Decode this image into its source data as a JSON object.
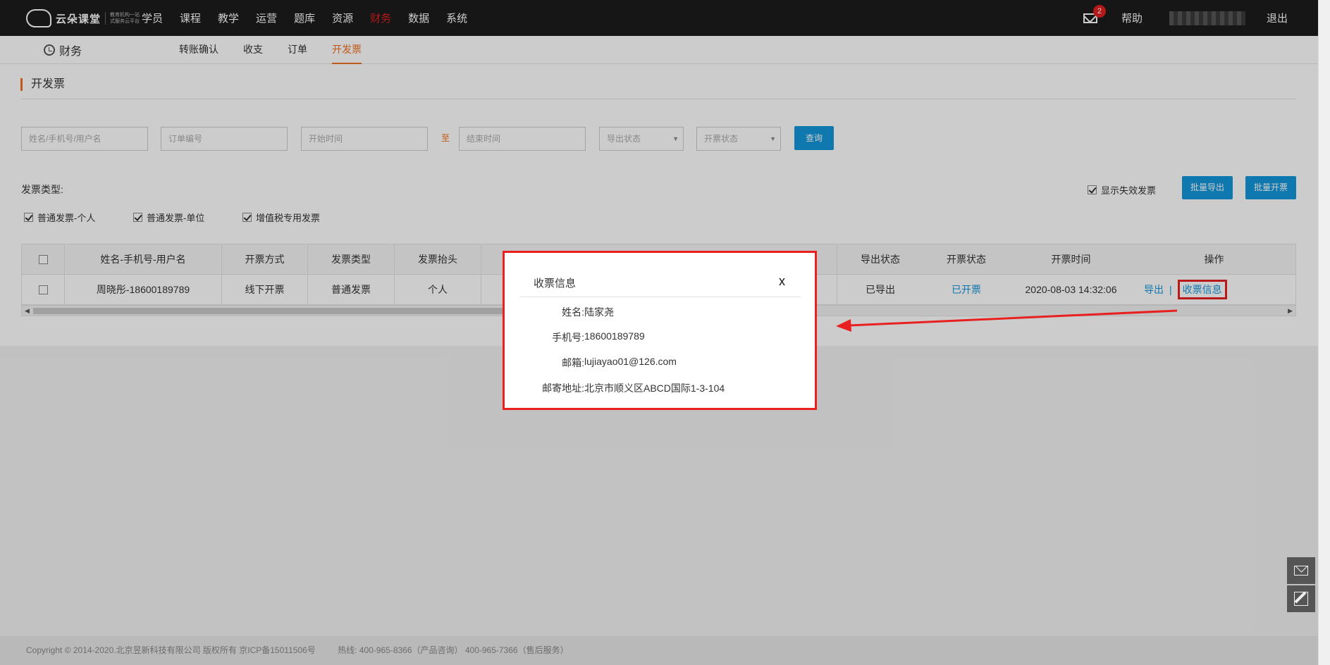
{
  "header": {
    "logo_brand": "云朵课堂",
    "logo_subtitle": "教育机构一站式服务云平台",
    "nav": [
      {
        "label": "学员",
        "active": false
      },
      {
        "label": "课程",
        "active": false
      },
      {
        "label": "教学",
        "active": false
      },
      {
        "label": "运营",
        "active": false
      },
      {
        "label": "题库",
        "active": false
      },
      {
        "label": "资源",
        "active": false
      },
      {
        "label": "财务",
        "active": true
      },
      {
        "label": "数据",
        "active": false
      },
      {
        "label": "系统",
        "active": false
      }
    ],
    "notification_count": "2",
    "help": "帮助",
    "logout": "退出",
    "accent_color": "#e02020"
  },
  "subnav": {
    "module": "财务",
    "tabs": [
      {
        "label": "转账确认",
        "active": false
      },
      {
        "label": "收支",
        "active": false
      },
      {
        "label": "订单",
        "active": false
      },
      {
        "label": "开发票",
        "active": true
      }
    ]
  },
  "page": {
    "title": "开发票",
    "filters": {
      "name_placeholder": "姓名/手机号/用户名",
      "order_placeholder": "订单编号",
      "start_placeholder": "开始时间",
      "to_label": "至",
      "end_placeholder": "结束时间",
      "export_status": "导出状态",
      "invoice_status": "开票状态",
      "query_button": "查询"
    },
    "invoice_type_label": "发票类型:",
    "invoice_types": [
      {
        "label": "普通发票-个人",
        "checked": true
      },
      {
        "label": "普通发票-单位",
        "checked": true
      },
      {
        "label": "增值税专用发票",
        "checked": true
      }
    ],
    "show_invalid": {
      "label": "显示失效发票",
      "checked": true
    },
    "batch_export": "批量导出",
    "batch_invoice": "批量开票"
  },
  "table": {
    "headers": {
      "name": "姓名-手机号-用户名",
      "method": "开票方式",
      "type": "发票类型",
      "title": "发票抬头",
      "export_status": "导出状态",
      "invoice_status": "开票状态",
      "invoice_time": "开票时间",
      "actions": "操作"
    },
    "rows": [
      {
        "name": "周晓彤-18600189789",
        "method": "线下开票",
        "type": "普通发票",
        "title": "个人",
        "export_status": "已导出",
        "invoice_status": "已开票",
        "invoice_time": "2020-08-03 14:32:06",
        "action_export": "导出",
        "action_info": "收票信息"
      }
    ]
  },
  "modal": {
    "title": "收票信息",
    "close": "x",
    "fields": [
      {
        "key": "姓名:",
        "value": "陆家尧"
      },
      {
        "key": "手机号:",
        "value": "18600189789"
      },
      {
        "key": "邮箱:",
        "value": "lujiayao01@126.com"
      },
      {
        "key": "邮寄地址:",
        "value": "北京市顺义区ABCD国际1-3-104"
      }
    ]
  },
  "footer": {
    "copyright": "Copyright © 2014-2020.北京昱新科技有限公司 版权所有 京ICP备15011506号",
    "hotline": "热线: 400-965-8366（产品咨询） 400-965-7366（售后服务）"
  }
}
